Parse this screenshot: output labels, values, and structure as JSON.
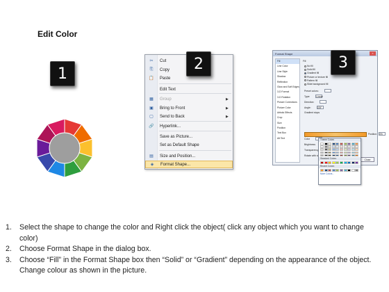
{
  "title": "Edit Color",
  "badges": [
    "1",
    "2",
    "3"
  ],
  "wheel": {
    "colors": [
      "#e53935",
      "#ef6c00",
      "#fbc02d",
      "#7cb342",
      "#2e9e3e",
      "#1e88e5",
      "#3949ab",
      "#6a1b9a",
      "#ad1457",
      "#d81b60"
    ],
    "center_color": "#9e9e9e"
  },
  "context_menu": {
    "items": [
      {
        "icon": "✂",
        "label": "Cut",
        "disabled": false,
        "submenu": false
      },
      {
        "icon": "⎘",
        "label": "Copy",
        "disabled": false,
        "submenu": false
      },
      {
        "icon": "📋",
        "label": "Paste",
        "disabled": false,
        "submenu": false
      },
      {
        "icon": "",
        "label": "Edit Text",
        "disabled": false,
        "submenu": false
      },
      {
        "icon": "▦",
        "label": "Group",
        "disabled": true,
        "submenu": true
      },
      {
        "icon": "▣",
        "label": "Bring to Front",
        "disabled": false,
        "submenu": true
      },
      {
        "icon": "▢",
        "label": "Send to Back",
        "disabled": false,
        "submenu": true
      },
      {
        "icon": "🔗",
        "label": "Hyperlink...",
        "disabled": false,
        "submenu": false
      },
      {
        "icon": "",
        "label": "Save as Picture...",
        "disabled": false,
        "submenu": false
      },
      {
        "icon": "",
        "label": "Set as Default Shape",
        "disabled": false,
        "submenu": false
      },
      {
        "icon": "▤",
        "label": "Size and Position...",
        "disabled": false,
        "submenu": false
      },
      {
        "icon": "◈",
        "label": "Format Shape...",
        "disabled": false,
        "submenu": false
      }
    ]
  },
  "format_dialog": {
    "title": "Format Shape",
    "close_label": "Close",
    "categories": [
      "Fill",
      "Line Color",
      "Line Style",
      "Shadow",
      "Reflection",
      "Glow and Soft Edges",
      "3-D Format",
      "3-D Rotation",
      "Picture Corrections",
      "Picture Color",
      "Artistic Effects",
      "Crop",
      "Size",
      "Position",
      "Text Box",
      "Alt Text"
    ],
    "fill_heading": "Fill",
    "fill_options": [
      "No fill",
      "Solid fill",
      "Gradient fill",
      "Picture or texture fill",
      "Pattern fill",
      "Slide background fill"
    ],
    "fields": [
      "Preset colors:",
      "Type:",
      "Direction:",
      "Angle:",
      "Gradient stops",
      "Color",
      "Brightness",
      "Transparency",
      "Rotate with shape"
    ],
    "type_value": "Linear",
    "angle_value": "225°",
    "position_label": "Position:",
    "position_value": "0%"
  },
  "palette": {
    "theme_heading": "Theme Colors",
    "standard_heading": "Standard Colors",
    "recent_heading": "Recent Colors",
    "more_label": "More Colors...",
    "theme_colors": [
      "#ffffff",
      "#000000",
      "#eeece1",
      "#1f497d",
      "#4f81bd",
      "#c0504d",
      "#9bbb59",
      "#8064a2",
      "#4bacc6",
      "#f79646",
      "#f2f2f2",
      "#7f7f7f",
      "#ddd9c3",
      "#c6d9f0",
      "#dbe5f1",
      "#f2dcdb",
      "#ebf1dd",
      "#e5e0ec",
      "#dbeef3",
      "#fdeada",
      "#d8d8d8",
      "#595959",
      "#c4bd97",
      "#8db3e2",
      "#b8cce4",
      "#e5b9b7",
      "#d7e3bc",
      "#ccc1d9",
      "#b7dde8",
      "#fbd5b5",
      "#bfbfbf",
      "#3f3f3f",
      "#938953",
      "#548dd4",
      "#95b3d7",
      "#d99694",
      "#c3d69b",
      "#b2a2c7",
      "#92cddc",
      "#fac08f",
      "#a5a5a5",
      "#262626",
      "#494429",
      "#17365d",
      "#366092",
      "#953734",
      "#76923c",
      "#5f497a",
      "#31859b",
      "#e36c09"
    ],
    "standard_colors": [
      "#c00000",
      "#ff0000",
      "#ffc000",
      "#ffff00",
      "#92d050",
      "#00b050",
      "#00b0f0",
      "#0070c0",
      "#002060",
      "#7030a0"
    ],
    "recent_colors": [
      "#f39a2a",
      "#1f497d",
      "#c0504d",
      "#4f81bd",
      "#9bbb59",
      "#8064a2",
      "#4bacc6",
      "#000000",
      "#ffffff",
      "#7f7f7f"
    ]
  },
  "instructions": [
    {
      "num": "1.",
      "text": "Select the shape to change the color and Right click the object( click any object which you want to change color)"
    },
    {
      "num": "2.",
      "text": "Choose Format Shape in the dialog box."
    },
    {
      "num": "3.",
      "text": "Choose “Fill” in the Format Shape box then “Solid” or “Gradient” depending on the appearance of the object. Change colour as shown in the picture."
    }
  ]
}
